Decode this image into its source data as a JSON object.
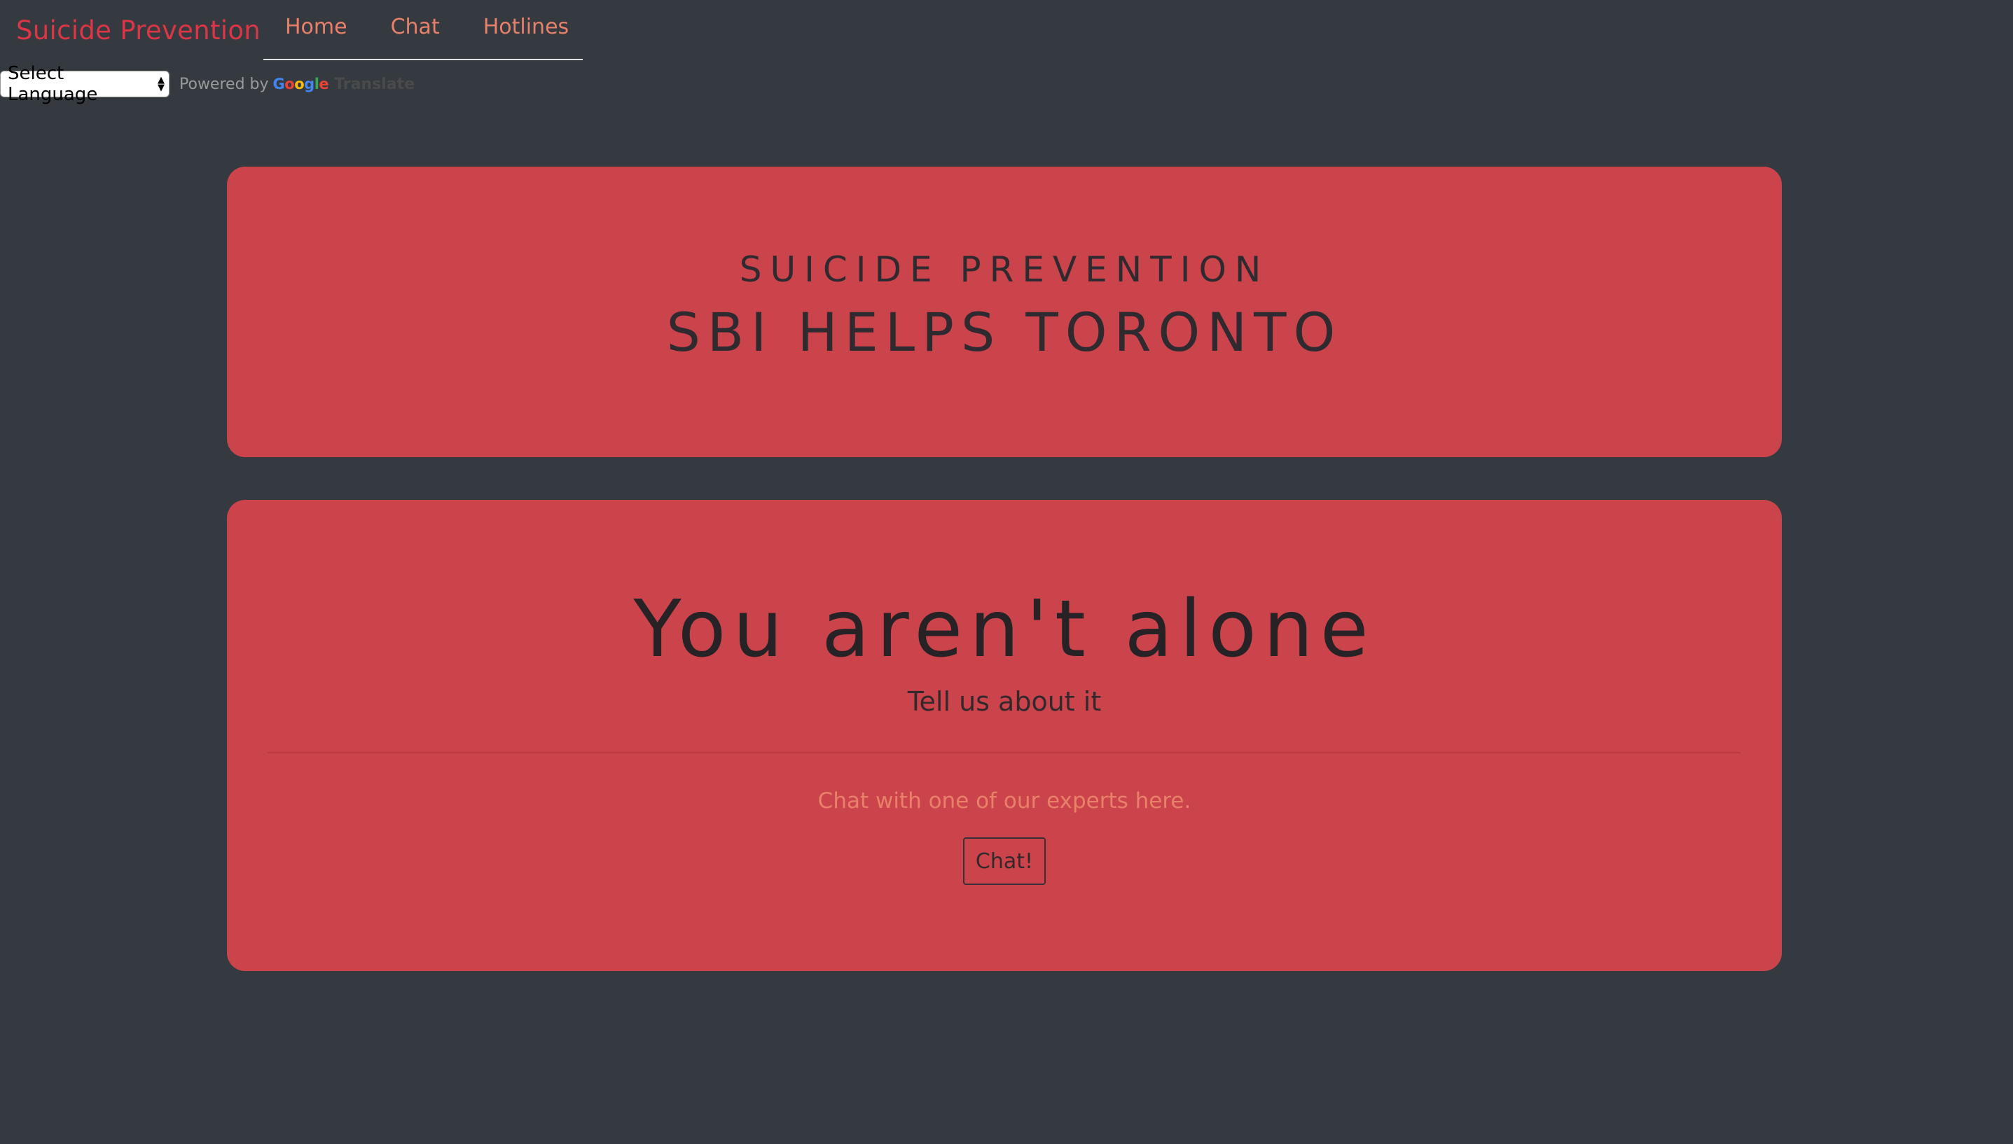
{
  "navbar": {
    "brand": "Suicide Prevention",
    "links": [
      "Home",
      "Chat",
      "Hotlines"
    ]
  },
  "translate": {
    "select_label": "Select Language",
    "powered_by": "Powered by",
    "google": [
      "G",
      "o",
      "o",
      "g",
      "l",
      "e"
    ],
    "translate_label": "Translate"
  },
  "hero": {
    "subtitle": "SUICIDE PREVENTION",
    "title": "SBI HELPS TORONTO"
  },
  "main": {
    "heading": "You aren't alone",
    "subheading": "Tell us about it",
    "chat_text": "Chat with one of our experts here.",
    "chat_button": "Chat!"
  },
  "colors": {
    "background": "#343a40",
    "card": "#cc444b",
    "brand": "#dc3545",
    "link": "#e8806a"
  }
}
